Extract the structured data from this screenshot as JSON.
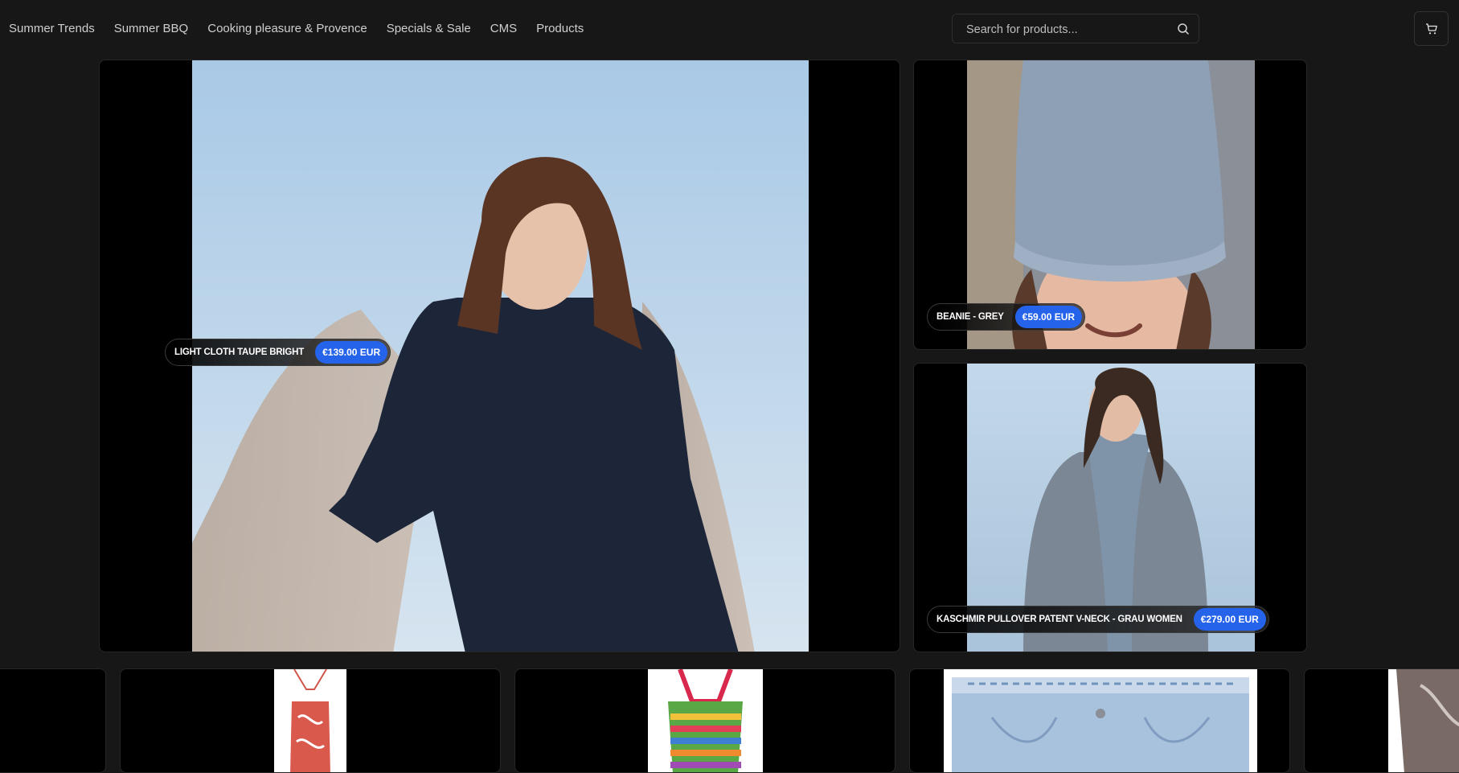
{
  "nav": {
    "items": [
      {
        "label": "Summer Trends"
      },
      {
        "label": "Summer BBQ"
      },
      {
        "label": "Cooking pleasure & Provence"
      },
      {
        "label": "Specials & Sale"
      },
      {
        "label": "CMS"
      },
      {
        "label": "Products"
      }
    ]
  },
  "search": {
    "placeholder": "Search for products...",
    "icon": "search-icon"
  },
  "cart": {
    "icon": "cart-icon"
  },
  "featured": [
    {
      "name": "LIGHT CLOTH TAUPE BRIGHT",
      "price": "€139.00 EUR"
    },
    {
      "name": "BEANIE - GREY",
      "price": "€59.00 EUR"
    },
    {
      "name": "KASCHMIR PULLOVER PATENT V-NECK - GRAU WOMEN",
      "price": "€279.00 EUR"
    }
  ],
  "colors": {
    "accent": "#2563eb",
    "background": "#171717"
  }
}
